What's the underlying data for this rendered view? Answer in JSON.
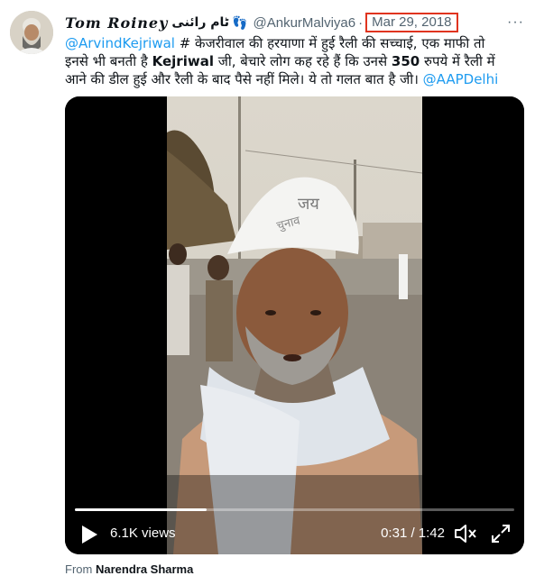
{
  "tweet": {
    "display_name": "Tom Roiney",
    "display_name_urdu": "ٹام رائنی",
    "feet_emoji": "👣",
    "handle": "@AnkurMalviya6",
    "separator": "·",
    "date": "Mar 29, 2018",
    "more_label": "···",
    "text": {
      "mention": "@ArvindKejriwal",
      "part1": " # केजरीवाल की हरयाणा में हुई रैली की सच्चाई, एक माफी तो इनसे भी बनती है ",
      "bold1": "Kejriwal",
      "part2": " जी, बेचारे लोग कह रहे हैं कि उनसे ",
      "bold2": "350",
      "part3": " रुपये में रैली में आने की डील हुई और रैली के बाद पैसे नहीं मिले। ये तो गलत बात है जी। ",
      "mention2": "@AAPDelhi"
    }
  },
  "video": {
    "views": "6.1K views",
    "time": "0:31 / 1:42",
    "progress": 0.3,
    "cap_text": "जय",
    "cap_text2": "चुनाव"
  },
  "attribution": {
    "prefix": "From",
    "source": "Narendra Sharma"
  },
  "colors": {
    "link": "#1d9bf0",
    "date_highlight": "#e0341f",
    "muted": "#536471"
  }
}
